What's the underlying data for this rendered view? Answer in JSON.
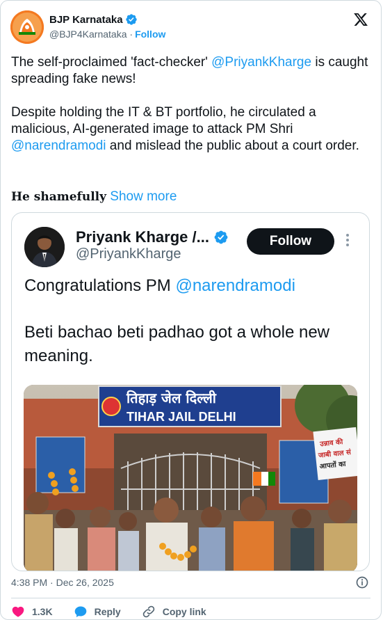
{
  "author": {
    "name": "BJP Karnataka",
    "handle": "@BJP4Karnataka",
    "follow_label": "Follow",
    "verified_icon": "verified-badge-icon",
    "platform_icon": "x-logo-icon"
  },
  "tweet": {
    "p1_pre": "The self-proclaimed 'fact-checker' ",
    "p1_mention": "@PriyankKharge",
    "p1_post": " is caught spreading fake news!",
    "p2_pre": "Despite holding the IT & BT portfolio, he circulated a malicious, AI-generated image to attack PM Shri ",
    "p2_mention": "@narendramodi",
    "p2_post": " and mislead the public about a court order.",
    "p3_bold": "He shamefully",
    "show_more": "Show more"
  },
  "quoted": {
    "name": "Priyank Kharge /...",
    "handle": "@PriyankKharge",
    "follow_label": "Follow",
    "text1_pre": "Congratulations PM ",
    "text1_mention": "@narendramodi",
    "text2": "Beti bachao beti padhao got a whole new meaning.",
    "photo": {
      "sign_hindi": "तिहाड़ जेल दिल्ली",
      "sign_english": "TIHAR JAIL DELHI",
      "side_banner": "उन्नाव की\nजाबी वाल सं\nआपतों का"
    }
  },
  "meta": {
    "timestamp": "4:38 PM · Dec 26, 2025"
  },
  "actions": {
    "like_count": "1.3K",
    "reply_label": "Reply",
    "copy_label": "Copy link"
  },
  "colors": {
    "accent": "#1d9bf0",
    "text": "#0f1419",
    "muted": "#536471",
    "like": "#f91880",
    "border": "#cfd9de"
  }
}
